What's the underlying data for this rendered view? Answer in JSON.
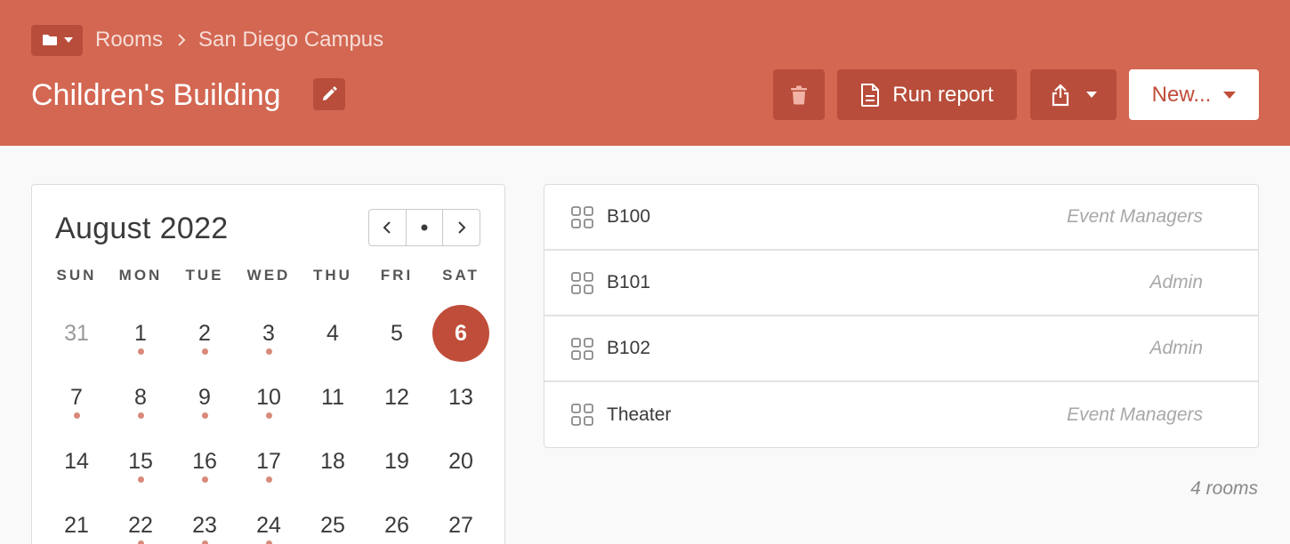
{
  "breadcrumb": {
    "items": [
      "Rooms",
      "San Diego Campus"
    ]
  },
  "header": {
    "title": "Children's Building",
    "report_label": "Run report",
    "new_label": "New..."
  },
  "calendar": {
    "month": "August",
    "year": "2022",
    "weekdays": [
      "SUN",
      "MON",
      "TUE",
      "WED",
      "THU",
      "FRI",
      "SAT"
    ],
    "weeks": [
      [
        "31",
        "1",
        "2",
        "3",
        "4",
        "5",
        "6"
      ],
      [
        "7",
        "8",
        "9",
        "10",
        "11",
        "12",
        "13"
      ],
      [
        "14",
        "15",
        "16",
        "17",
        "18",
        "19",
        "20"
      ],
      [
        "21",
        "22",
        "23",
        "24",
        "25",
        "26",
        "27"
      ]
    ],
    "muted_days": [
      "31"
    ],
    "today": "6",
    "days_with_events": [
      "1",
      "2",
      "3",
      "7",
      "8",
      "9",
      "10",
      "15",
      "16",
      "17",
      "22",
      "23",
      "24"
    ]
  },
  "rooms": {
    "items": [
      {
        "name": "B100",
        "owner": "Event Managers"
      },
      {
        "name": "B101",
        "owner": "Admin"
      },
      {
        "name": "B102",
        "owner": "Admin"
      },
      {
        "name": "Theater",
        "owner": "Event Managers"
      }
    ],
    "count_label": "4 rooms"
  },
  "colors": {
    "header_bg": "#d36752",
    "accent": "#c04d39",
    "button_bg": "#b84d3b",
    "event_dot": "#d88a7a"
  },
  "icons": {
    "folder_menu": "folder-icon",
    "breadcrumb_separator": "chevron-right-icon",
    "edit": "pencil-icon",
    "delete": "trash-icon",
    "report": "document-icon",
    "share": "share-icon",
    "dropdown": "caret-down-icon",
    "room": "grid-icon"
  }
}
